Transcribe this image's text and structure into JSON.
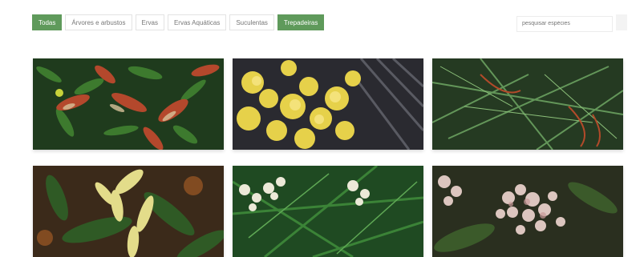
{
  "filters": [
    {
      "label": "Todas",
      "active": true
    },
    {
      "label": "Árvores e arbustos",
      "active": false
    },
    {
      "label": "Ervas",
      "active": false
    },
    {
      "label": "Ervas Aquáticas",
      "active": false
    },
    {
      "label": "Suculentas",
      "active": false
    },
    {
      "label": "Trepadeiras",
      "active": true
    }
  ],
  "search": {
    "placeholder": "pesquisar espécies"
  },
  "gallery": [
    {
      "name": "species-photo-1"
    },
    {
      "name": "species-photo-2"
    },
    {
      "name": "species-photo-3"
    },
    {
      "name": "species-photo-4"
    },
    {
      "name": "species-photo-5"
    },
    {
      "name": "species-photo-6"
    }
  ],
  "colors": {
    "accent": "#5f9a5b"
  }
}
